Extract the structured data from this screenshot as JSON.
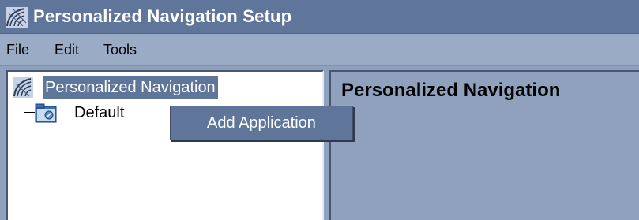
{
  "window": {
    "title": "Personalized Navigation Setup",
    "icon": "globe-grid-icon"
  },
  "menubar": {
    "items": [
      "File",
      "Edit",
      "Tools"
    ]
  },
  "tree": {
    "root": {
      "label": "Personalized Navigation",
      "icon": "globe-grid-icon",
      "selected": true
    },
    "children": [
      {
        "label": "Default",
        "icon": "folder-icon"
      }
    ]
  },
  "context_menu": {
    "items": [
      "Add Application"
    ]
  },
  "detail_panel": {
    "title": "Personalized Navigation"
  },
  "colors": {
    "titlebar": "#5f7599",
    "menubar": "#9aabc6",
    "background": "#8fa1bd",
    "selection": "#5f7599"
  }
}
